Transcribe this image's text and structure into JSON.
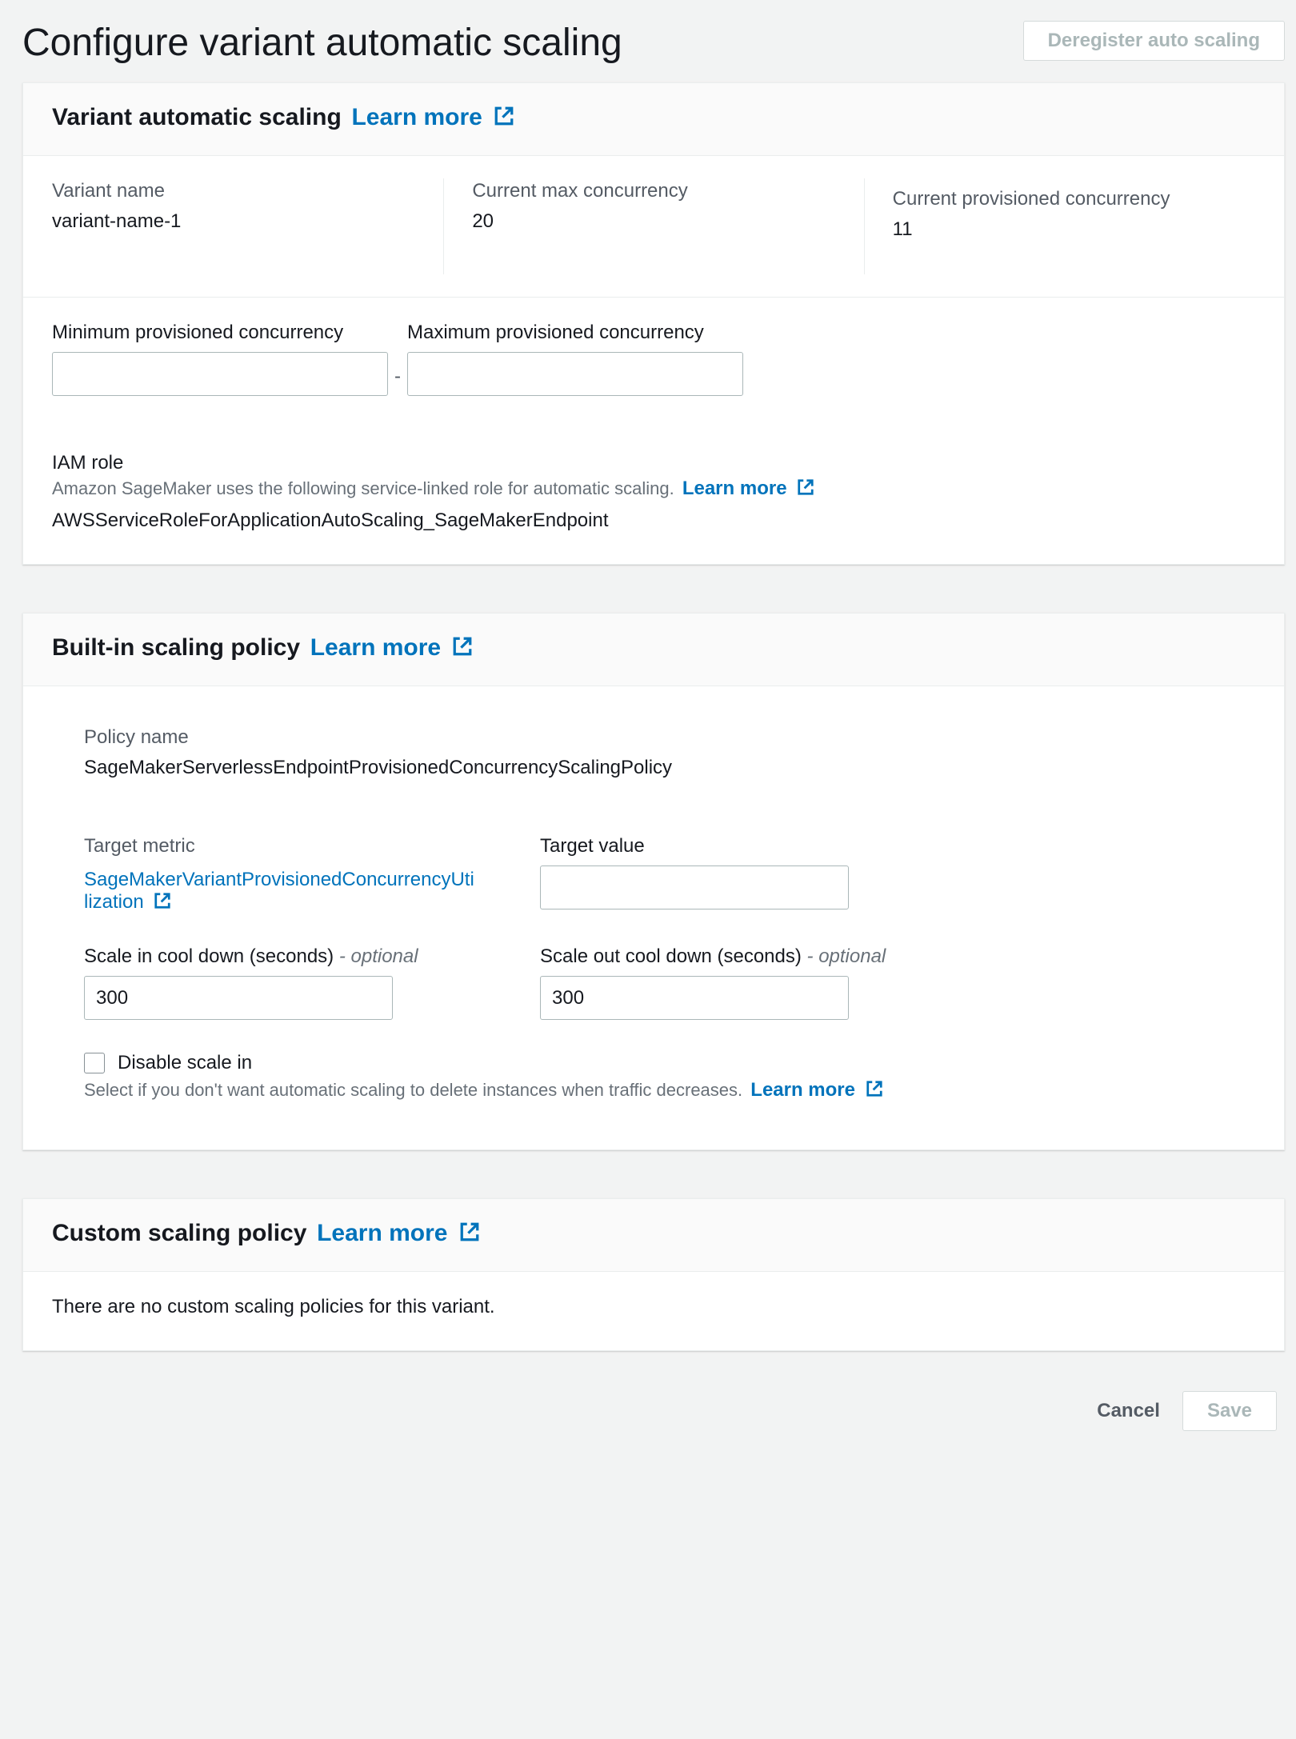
{
  "header": {
    "title": "Configure variant automatic scaling",
    "deregister_label": "Deregister auto scaling"
  },
  "variant_panel": {
    "title": "Variant automatic scaling",
    "learn_more": "Learn more",
    "info": {
      "variant_name_label": "Variant name",
      "variant_name_value": "variant-name-1",
      "current_max_label": "Current max concurrency",
      "current_max_value": "20",
      "current_prov_label": "Current provisioned concurrency",
      "current_prov_value": "11"
    },
    "min_label": "Minimum provisioned concurrency",
    "max_label": "Maximum provisioned concurrency",
    "min_value": "",
    "max_value": "",
    "iam": {
      "title": "IAM role",
      "desc": "Amazon SageMaker uses the following service-linked role for automatic scaling.",
      "learn_more": "Learn more",
      "value": "AWSServiceRoleForApplicationAutoScaling_SageMakerEndpoint"
    }
  },
  "builtin_panel": {
    "title": "Built-in scaling policy",
    "learn_more": "Learn more",
    "policy_name_label": "Policy name",
    "policy_name_value": "SageMakerServerlessEndpointProvisionedConcurrencyScalingPolicy",
    "target_metric_label": "Target metric",
    "target_metric_value": "SageMakerVariantProvisionedConcurrencyUtilization",
    "target_value_label": "Target value",
    "target_value": "",
    "scale_in_label": "Scale in cool down (seconds)",
    "scale_out_label": "Scale out cool down (seconds)",
    "optional": "- optional",
    "scale_in_value": "300",
    "scale_out_value": "300",
    "disable_label": "Disable scale in",
    "disable_help": "Select if you don't want automatic scaling to delete instances when traffic decreases.",
    "disable_learn_more": "Learn more"
  },
  "custom_panel": {
    "title": "Custom scaling policy",
    "learn_more": "Learn more",
    "empty": "There are no custom scaling policies for this variant."
  },
  "footer": {
    "cancel": "Cancel",
    "save": "Save"
  }
}
